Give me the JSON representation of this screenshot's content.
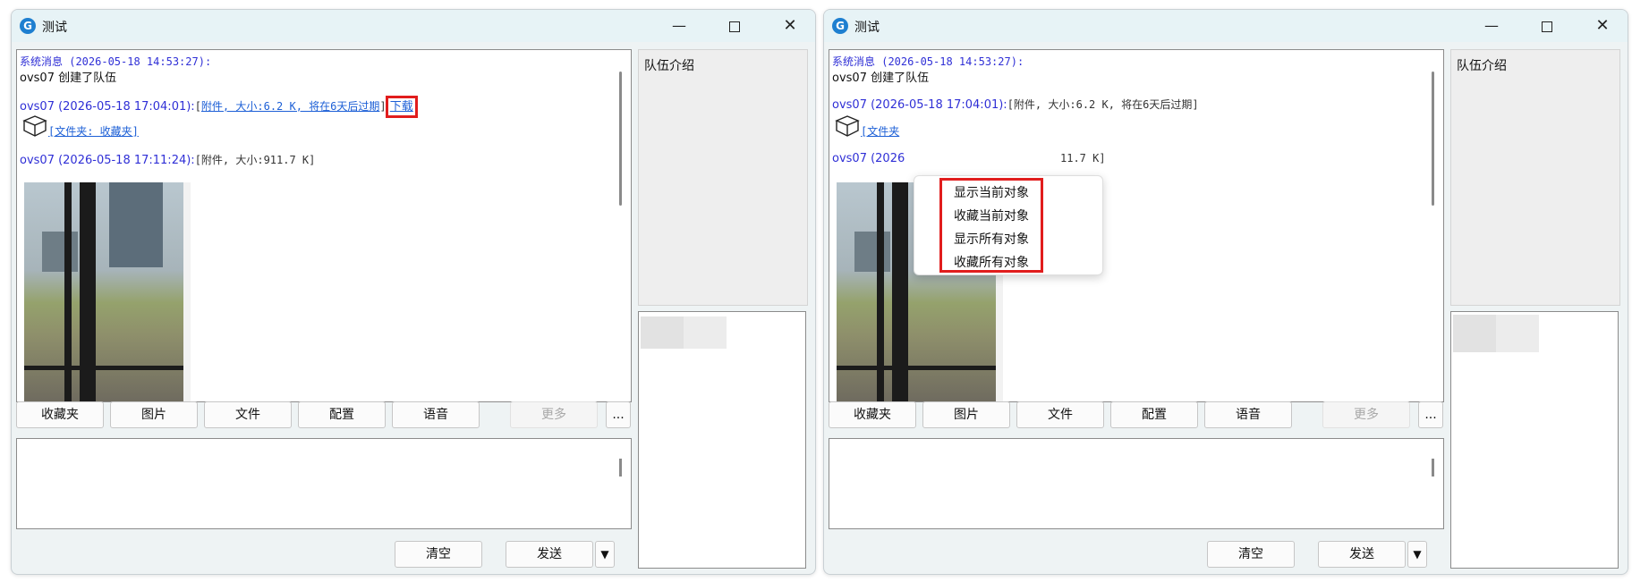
{
  "window": {
    "title": "测试"
  },
  "chat": {
    "system_line": "系统消息 (2026-05-18 14:53:27):",
    "system_body": "ovs07 创建了队伍",
    "msg1_sender": "ovs07 (2026-05-18 17:04:01):",
    "msg1_open": "[",
    "msg1_attachment": "附件, 大小:6.2 K, 将在6天后过期",
    "msg1_close": "]",
    "msg1_download": "下载",
    "msg1_folder": "[文件夹: 收藏夹]",
    "msg1_folder_partial": "[文件夹",
    "msg2_sender": "ovs07 (2026-05-18 17:11:24):",
    "msg2_attachment": "[附件, 大小:911.7 K]",
    "msg2_sender_partial": "ovs07 (2026",
    "msg2_attachment_partial": "11.7 K]"
  },
  "toolbar": {
    "favorites": "收藏夹",
    "image": "图片",
    "file": "文件",
    "config": "配置",
    "voice": "语音",
    "more": "更多",
    "ellipsis": "..."
  },
  "actions": {
    "clear": "清空",
    "send": "发送",
    "dropdown": "▼"
  },
  "side": {
    "intro_label": "队伍介绍"
  },
  "context_menu": {
    "items": [
      "显示当前对象",
      "收藏当前对象",
      "显示所有对象",
      "收藏所有对象"
    ]
  },
  "colors": {
    "highlight": "#e11d1d",
    "link": "#1c5fd6",
    "sender": "#2f2fd6"
  }
}
